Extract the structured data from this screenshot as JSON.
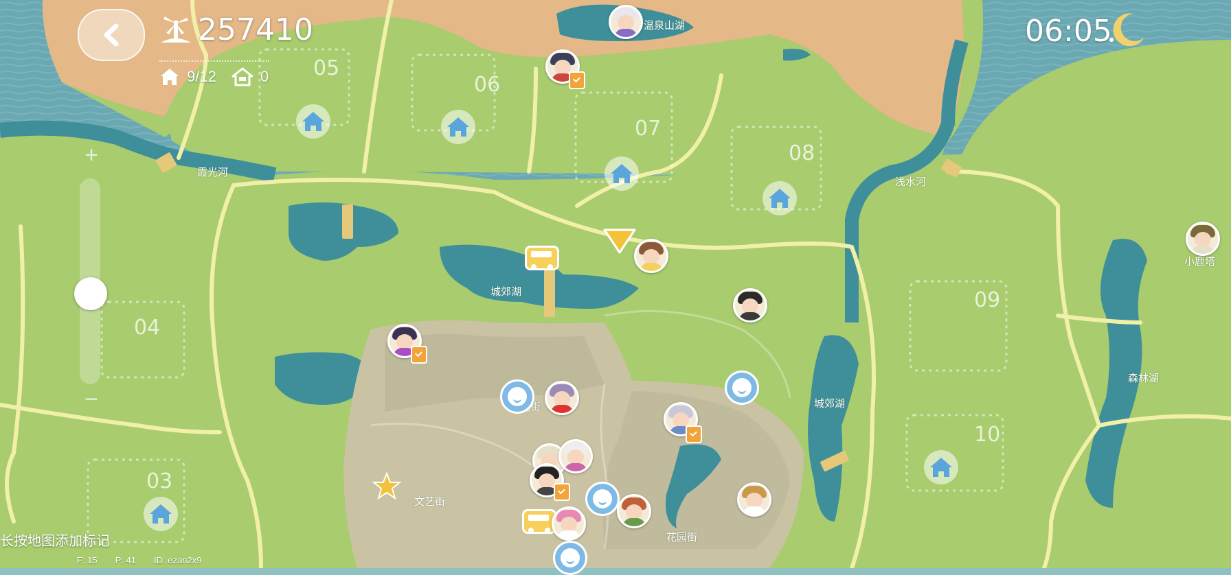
{
  "hud": {
    "coins": "257410",
    "houses": "9/12",
    "homes_other": "0",
    "time": "06:05"
  },
  "hint": "长按地图添加标记",
  "debug": {
    "f": "F: 15",
    "p": "P: 41",
    "id": "ID: ezan2x9"
  },
  "map_labels": {
    "hot_spring_lake": "温泉山湖",
    "xiaguang_river": "霞光河",
    "qianshui_river": "浅水河",
    "suburb_lake_1": "城郊湖",
    "suburb_lake_2": "城郊湖",
    "forest_lake": "森林湖",
    "xiaolu_tower": "小鹿塔",
    "wenyi_street": "文艺街",
    "huayuan_street": "花园街",
    "hidden_street": "花街"
  },
  "plots": [
    "05",
    "06",
    "07",
    "08",
    "04",
    "09",
    "03",
    "10"
  ],
  "colors": {
    "grass": "#a8cc6e",
    "water": "#3f8f9a",
    "road": "#f2f0a8",
    "desert": "#e4b887",
    "town": "#c9c3a4",
    "house_icon": "#5aa6dc",
    "task_badge": "#f2a43a"
  },
  "icons": {
    "back": "chevron-left-icon",
    "coins": "windmill-icon",
    "house": "house-icon",
    "home_other": "home-outline-icon",
    "night": "moon-icon",
    "marker": "triangle-marker-icon",
    "bus": "bus-icon",
    "star": "star-icon"
  }
}
